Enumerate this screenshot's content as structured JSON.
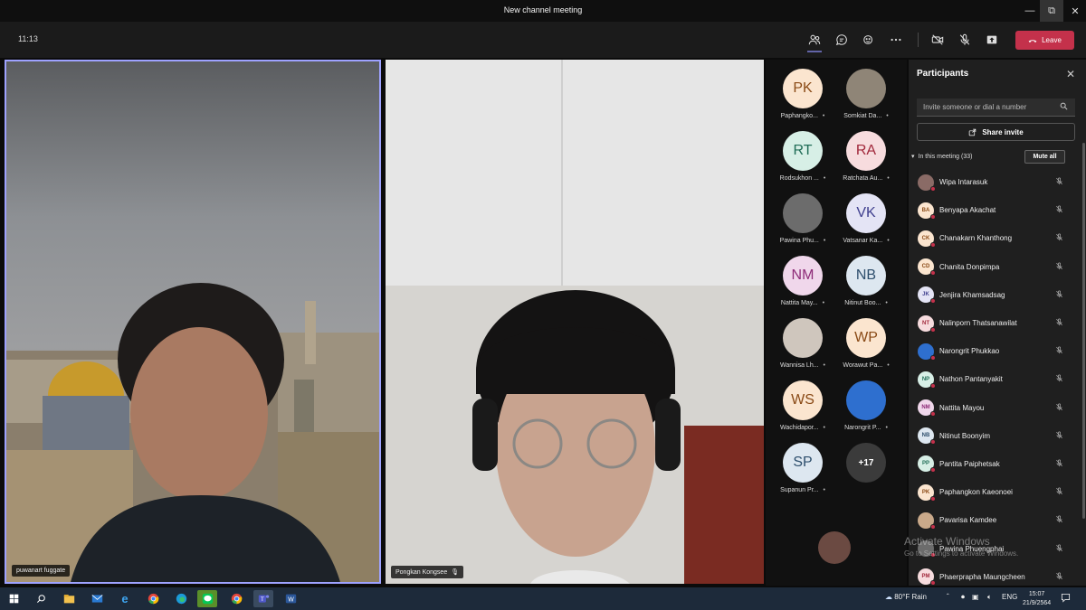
{
  "window": {
    "title": "New channel meeting"
  },
  "toolbar": {
    "time": "11:13",
    "leave_label": "Leave"
  },
  "videos": [
    {
      "name": "puwanart fuggate"
    },
    {
      "name": "Pongkan Kongsee"
    }
  ],
  "gallery": [
    {
      "initials": "PK",
      "name": "Paphangko...",
      "bg": "#fbe5cf",
      "fg": "#8a4a16",
      "photo": false
    },
    {
      "initials": "",
      "name": "Somkiat Da...",
      "bg": "#8f8577",
      "fg": "#fff",
      "photo": true
    },
    {
      "initials": "RT",
      "name": "Rodsukhon ...",
      "bg": "#d7efe6",
      "fg": "#1f6c56",
      "photo": false
    },
    {
      "initials": "RA",
      "name": "Ratchata Au...",
      "bg": "#f7dcde",
      "fg": "#a1283b",
      "photo": false
    },
    {
      "initials": "",
      "name": "Pawina Phu...",
      "bg": "#6c6c6c",
      "fg": "#fff",
      "photo": true
    },
    {
      "initials": "VK",
      "name": "Vatsanar Ka...",
      "bg": "#e4e4f5",
      "fg": "#3f3f8e",
      "photo": false
    },
    {
      "initials": "NM",
      "name": "Nattita May...",
      "bg": "#f0d7eb",
      "fg": "#8e2b78",
      "photo": false
    },
    {
      "initials": "NB",
      "name": "Nitinut Boo...",
      "bg": "#dde7f0",
      "fg": "#2d4e6c",
      "photo": false
    },
    {
      "initials": "",
      "name": "Wannisa Lh...",
      "bg": "#cfc6bd",
      "fg": "#fff",
      "photo": true
    },
    {
      "initials": "WP",
      "name": "Worawut Pa...",
      "bg": "#fbe5cf",
      "fg": "#8a4a16",
      "photo": false
    },
    {
      "initials": "WS",
      "name": "Wachidapor...",
      "bg": "#fbe5cf",
      "fg": "#8a4a16",
      "photo": false
    },
    {
      "initials": "",
      "name": "Narongrit P...",
      "bg": "#2e6fcf",
      "fg": "#fff",
      "photo": true
    },
    {
      "initials": "SP",
      "name": "Supanun Pr...",
      "bg": "#dde7f0",
      "fg": "#2d4e6c",
      "photo": false
    },
    {
      "initials": "+17",
      "name": "",
      "bg": "#3b3b3b",
      "fg": "#fff",
      "photo": false
    }
  ],
  "panel": {
    "title": "Participants",
    "invite_placeholder": "Invite someone or dial a number",
    "share_label": "Share invite",
    "in_meeting_label": "In this meeting (33)",
    "mute_all_label": "Mute all",
    "participants": [
      {
        "initials": "",
        "name": "Wipa Intarasuk",
        "bg": "#8a6b66",
        "fg": "#fff"
      },
      {
        "initials": "BA",
        "name": "Benyapa Akachat",
        "bg": "#fbe5cf",
        "fg": "#8a4a16"
      },
      {
        "initials": "CK",
        "name": "Chanakarn Khanthong",
        "bg": "#fbe5cf",
        "fg": "#8a4a16"
      },
      {
        "initials": "CD",
        "name": "Chanita Donpimpa",
        "bg": "#fbe5cf",
        "fg": "#8a4a16"
      },
      {
        "initials": "JK",
        "name": "Jenjira Khamsadsag",
        "bg": "#e4e4f5",
        "fg": "#3f3f8e"
      },
      {
        "initials": "NT",
        "name": "Nalinporn Thatsanawilat",
        "bg": "#f7dcde",
        "fg": "#a1283b"
      },
      {
        "initials": "",
        "name": "Narongrit Phukkao",
        "bg": "#2e6fcf",
        "fg": "#fff"
      },
      {
        "initials": "NP",
        "name": "Nathon Pantanyakit",
        "bg": "#d7efe6",
        "fg": "#1f6c56"
      },
      {
        "initials": "NM",
        "name": "Nattita Mayou",
        "bg": "#f0d7eb",
        "fg": "#8e2b78"
      },
      {
        "initials": "NB",
        "name": "Nitinut Boonyim",
        "bg": "#dde7f0",
        "fg": "#2d4e6c"
      },
      {
        "initials": "PP",
        "name": "Pantita Paiphetsak",
        "bg": "#d7efe6",
        "fg": "#1f6c56"
      },
      {
        "initials": "PK",
        "name": "Paphangkon Kaeonoei",
        "bg": "#fbe5cf",
        "fg": "#8a4a16"
      },
      {
        "initials": "",
        "name": "Pavarisa Kamdee",
        "bg": "#c9a98a",
        "fg": "#fff"
      },
      {
        "initials": "",
        "name": "Pawina Phuengphai",
        "bg": "#6c6c6c",
        "fg": "#fff"
      },
      {
        "initials": "PM",
        "name": "Phaerprapha Maungcheen",
        "bg": "#f7dcde",
        "fg": "#a1283b"
      }
    ]
  },
  "watermark": {
    "line1": "Activate Windows",
    "line2": "Go to Settings to activate Windows."
  },
  "taskbar": {
    "weather": "80°F  Rain",
    "language": "ENG",
    "time": "15:07",
    "date": "21/9/2564"
  }
}
